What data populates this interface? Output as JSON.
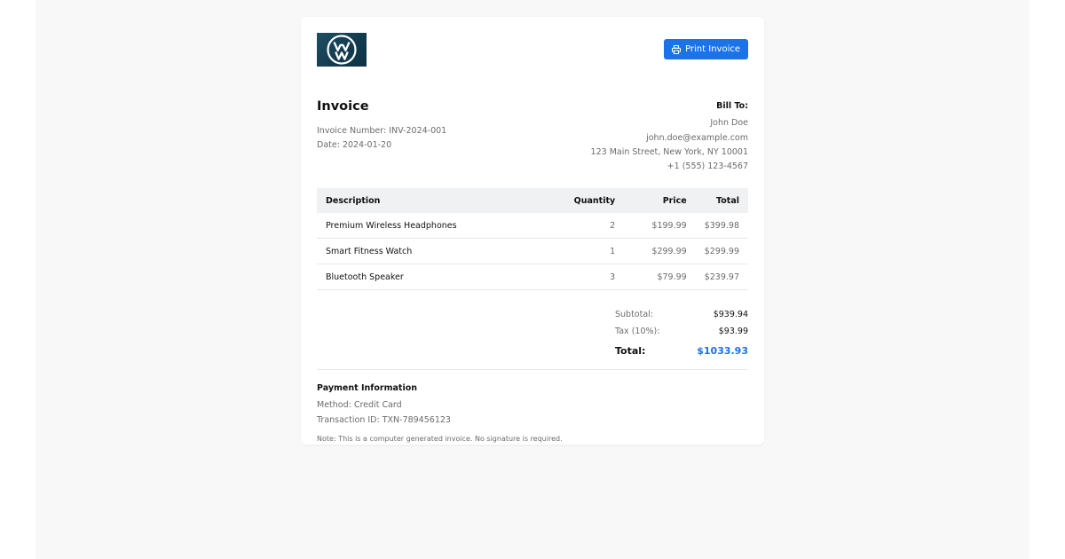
{
  "colors": {
    "accent": "#1a73e8",
    "page_background": "#f8f8f8",
    "table_header_background": "#f0f1f3"
  },
  "logo": {
    "icon": "vw-logo-icon"
  },
  "header": {
    "print_button": {
      "label": "Print Invoice",
      "icon": "printer-icon"
    }
  },
  "invoice": {
    "title": "Invoice",
    "number_line": "Invoice Number: INV-2024-001",
    "date_line": "Date: 2024-01-20"
  },
  "bill_to": {
    "heading": "Bill To:",
    "name": "John Doe",
    "email": "john.doe@example.com",
    "address": "123 Main Street, New York, NY 10001",
    "phone": "+1 (555) 123-4567"
  },
  "items_table": {
    "columns": [
      "Description",
      "Quantity",
      "Price",
      "Total"
    ],
    "rows": [
      {
        "description": "Premium Wireless Headphones",
        "quantity": "2",
        "price": "$199.99",
        "total": "$399.98"
      },
      {
        "description": "Smart Fitness Watch",
        "quantity": "1",
        "price": "$299.99",
        "total": "$299.99"
      },
      {
        "description": "Bluetooth Speaker",
        "quantity": "3",
        "price": "$79.99",
        "total": "$239.97"
      }
    ]
  },
  "totals": {
    "subtotal_label": "Subtotal:",
    "subtotal_value": "$939.94",
    "tax_label": "Tax (10%):",
    "tax_value": "$93.99",
    "total_label": "Total:",
    "total_value": "$1033.93"
  },
  "payment": {
    "heading": "Payment Information",
    "method": "Method: Credit Card",
    "transaction": "Transaction ID: TXN-789456123",
    "note": "Note: This is a computer generated invoice. No signature is required."
  }
}
